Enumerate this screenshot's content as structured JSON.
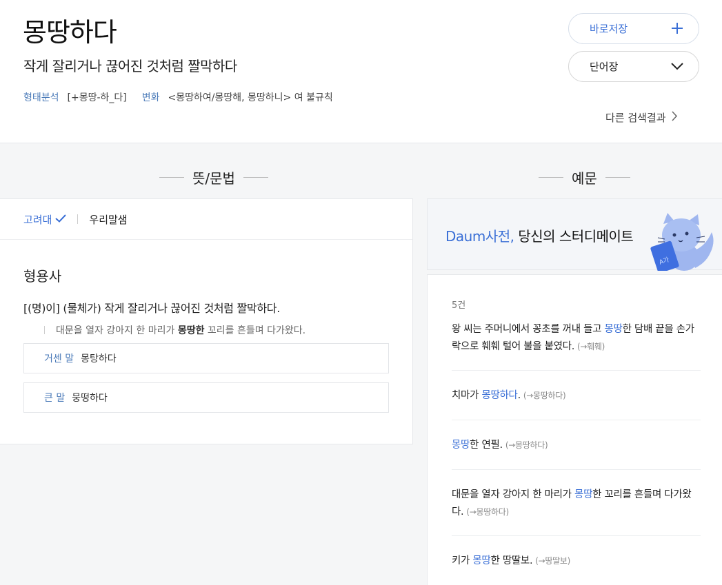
{
  "header": {
    "word": "몽땅하다",
    "summary": "작게 잘리거나 끊어진 것처럼 짤막하다",
    "morph_label": "형태분석",
    "morph_value": "[+몽땅-하_다]",
    "change_label": "변화",
    "change_value": "<몽땅하여/몽땅해, 몽땅하니> 여 불규칙",
    "save_button": "바로저장",
    "vocab_button": "단어장",
    "other_results": "다른 검색결과"
  },
  "sections": {
    "meaning_title": "뜻/문법",
    "examples_title": "예문"
  },
  "meaning": {
    "tab_active": "고려대",
    "tab_other": "우리말샘",
    "pos": "형용사",
    "definition": "[(명)이] (물체가) 작게 잘리거나 끊어진 것처럼 짤막하다.",
    "example_pre": "대문을 열자 강아지 한 마리가 ",
    "example_bold": "몽땅한",
    "example_post": " 꼬리를 흔들며 다가왔다.",
    "related": [
      {
        "key": "거센 말",
        "value": "몽탕하다"
      },
      {
        "key": "큰 말",
        "value": "뭉떵하다"
      }
    ]
  },
  "banner": {
    "brand": "Daum사전,",
    "text": " 당신의 스터디메이트"
  },
  "examples": {
    "count": "5건",
    "items": [
      {
        "pre": "왕 씨는 주머니에서 꽁초를 꺼내 들고 ",
        "hl": "몽땅",
        "post": "한 담배 끝을 손가락으로 훼훼 털어 불을 붙였다.",
        "src": "(→훼훼)"
      },
      {
        "pre": "치마가 ",
        "hl": "몽땅하다",
        "post": ".",
        "src": "(→몽땅하다)"
      },
      {
        "pre": "",
        "hl": "몽땅",
        "post": "한 연필.",
        "src": "(→몽땅하다)"
      },
      {
        "pre": "대문을 열자 강아지 한 마리가 ",
        "hl": "몽땅",
        "post": "한 꼬리를 흔들며 다가왔다.",
        "src": "(→몽땅하다)"
      },
      {
        "pre": "키가 ",
        "hl": "몽땅",
        "post": "한 땅딸보.",
        "src": "(→땅딸보)"
      }
    ]
  },
  "icons": {
    "plus": "plus-icon",
    "chevron_down": "chevron-down-icon",
    "chevron_right": "chevron-right-icon",
    "check": "check-icon",
    "mascot": "cat-mascot"
  },
  "colors": {
    "accent": "#3a6fd6",
    "label": "#4a7ab8",
    "mascot": "#9fb6ef"
  }
}
